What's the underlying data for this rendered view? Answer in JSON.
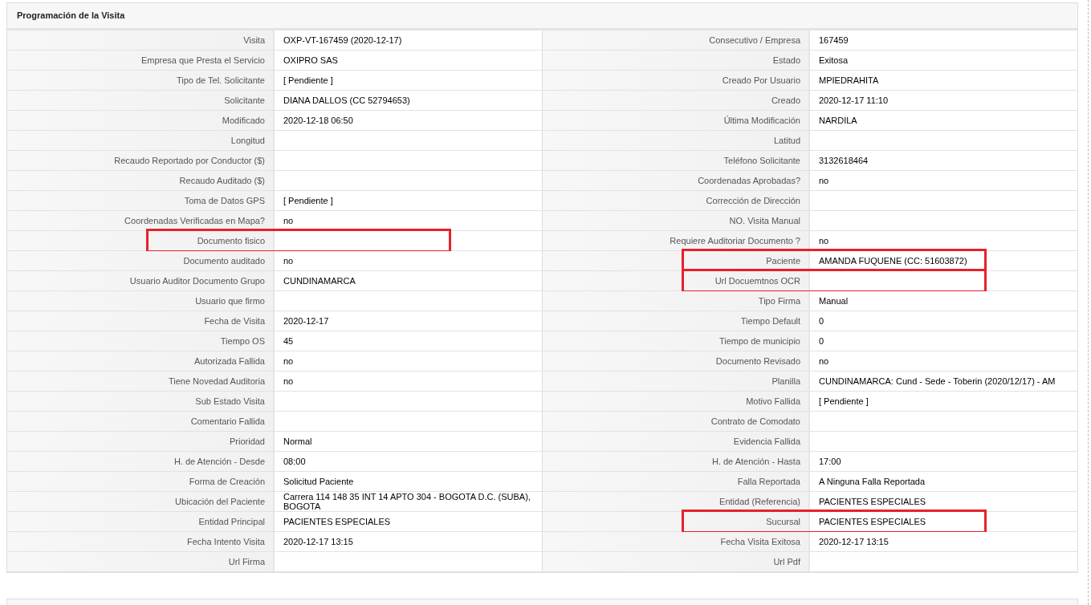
{
  "panel": {
    "title": "Programación de la Visita"
  },
  "rows": [
    {
      "left": {
        "label": "Visita",
        "value": "OXP-VT-167459 (2020-12-17)",
        "highlighted": false
      },
      "right": {
        "label": "Consecutivo / Empresa",
        "value": "167459",
        "highlighted": false
      }
    },
    {
      "left": {
        "label": "Empresa que Presta el Servicio",
        "value": "OXIPRO SAS",
        "highlighted": false
      },
      "right": {
        "label": "Estado",
        "value": "Exitosa",
        "highlighted": false
      }
    },
    {
      "left": {
        "label": "Tipo de Tel. Solicitante",
        "value": "[ Pendiente ]",
        "highlighted": false
      },
      "right": {
        "label": "Creado Por Usuario",
        "value": "MPIEDRAHITA",
        "highlighted": false
      }
    },
    {
      "left": {
        "label": "Solicitante",
        "value": "DIANA DALLOS (CC 52794653)",
        "highlighted": false
      },
      "right": {
        "label": "Creado",
        "value": "2020-12-17 11:10",
        "highlighted": false
      }
    },
    {
      "left": {
        "label": "Modificado",
        "value": "2020-12-18 06:50",
        "highlighted": false
      },
      "right": {
        "label": "Última Modificación",
        "value": "NARDILA",
        "highlighted": false
      }
    },
    {
      "left": {
        "label": "Longitud",
        "highlighted": false
      },
      "right": {
        "label": "Latitud",
        "highlighted": false
      }
    },
    {
      "left": {
        "label": "Recaudo Reportado por Conductor ($)",
        "highlighted": false
      },
      "right": {
        "label": "Teléfono Solicitante",
        "value": "3132618464",
        "highlighted": false
      }
    },
    {
      "left": {
        "label": "Recaudo Auditado ($)",
        "highlighted": false
      },
      "right": {
        "label": "Coordenadas Aprobadas?",
        "value": "no",
        "highlighted": false
      }
    },
    {
      "left": {
        "label": "Toma de Datos GPS",
        "value": "[ Pendiente ]",
        "highlighted": false
      },
      "right": {
        "label": "Corrección de Dirección",
        "highlighted": false
      }
    },
    {
      "left": {
        "label": "Coordenadas Verificadas en Mapa?",
        "value": "no",
        "highlighted": false
      },
      "right": {
        "label": "NO. Visita Manual",
        "highlighted": false
      }
    },
    {
      "left": {
        "label": "Documento fisico",
        "highlighted": true
      },
      "right": {
        "label": "Requiere Auditoriar Documento ?",
        "value": "no",
        "highlighted": false
      }
    },
    {
      "left": {
        "label": "Documento auditado",
        "value": "no",
        "highlighted": false
      },
      "right": {
        "label": "Paciente",
        "value": "AMANDA FUQUENE (CC: 51603872)",
        "highlighted": true
      }
    },
    {
      "left": {
        "label": "Usuario Auditor Documento Grupo",
        "value": "CUNDINAMARCA",
        "highlighted": false
      },
      "right": {
        "label": "Url Docuemtnos OCR",
        "highlighted": true
      }
    },
    {
      "left": {
        "label": "Usuario que firmo",
        "highlighted": false
      },
      "right": {
        "label": "Tipo Firma",
        "value": "Manual",
        "highlighted": false
      }
    },
    {
      "left": {
        "label": "Fecha de Visita",
        "value": "2020-12-17",
        "highlighted": false
      },
      "right": {
        "label": "Tiempo Default",
        "value": "0",
        "highlighted": false
      }
    },
    {
      "left": {
        "label": "Tiempo OS",
        "value": "45",
        "highlighted": false
      },
      "right": {
        "label": "Tiempo de municipio",
        "value": "0",
        "highlighted": false
      }
    },
    {
      "left": {
        "label": "Autorizada Fallida",
        "value": "no",
        "highlighted": false
      },
      "right": {
        "label": "Documento Revisado",
        "value": "no",
        "highlighted": false
      }
    },
    {
      "left": {
        "label": "Tiene Novedad Auditoria",
        "value": "no",
        "highlighted": false
      },
      "right": {
        "label": "Planilla",
        "value": "CUNDINAMARCA: Cund - Sede - Toberin (2020/12/17) - AM",
        "highlighted": false
      }
    },
    {
      "left": {
        "label": "Sub Estado Visita",
        "highlighted": false
      },
      "right": {
        "label": "Motivo Fallida",
        "value": "[ Pendiente ]",
        "highlighted": false
      }
    },
    {
      "left": {
        "label": "Comentario Fallida",
        "highlighted": false
      },
      "right": {
        "label": "Contrato de Comodato",
        "highlighted": false
      }
    },
    {
      "left": {
        "label": "Prioridad",
        "value": "Normal",
        "highlighted": false
      },
      "right": {
        "label": "Evidencia Fallida",
        "highlighted": false
      }
    },
    {
      "left": {
        "label": "H. de Atención - Desde",
        "value": "08:00",
        "highlighted": false
      },
      "right": {
        "label": "H. de Atención - Hasta",
        "value": "17:00",
        "highlighted": false
      }
    },
    {
      "left": {
        "label": "Forma de Creación",
        "value": "Solicitud Paciente",
        "highlighted": false
      },
      "right": {
        "label": "Falla Reportada",
        "value": "A Ninguna Falla Reportada",
        "highlighted": false
      }
    },
    {
      "left": {
        "label": "Ubicación del Paciente",
        "value": "Carrera 114 148 35 INT 14 APTO 304 - BOGOTA D.C. (SUBA), BOGOTA",
        "highlighted": false
      },
      "right": {
        "label": "Entidad (Referencia)",
        "value": "PACIENTES ESPECIALES",
        "highlighted": false
      }
    },
    {
      "left": {
        "label": "Entidad Principal",
        "value": "PACIENTES ESPECIALES",
        "highlighted": false
      },
      "right": {
        "label": "Sucursal",
        "value": "PACIENTES ESPECIALES",
        "highlighted": true
      }
    },
    {
      "left": {
        "label": "Fecha Intento Visita",
        "value": "2020-12-17 13:15",
        "highlighted": false
      },
      "right": {
        "label": "Fecha Visita Exitosa",
        "value": "2020-12-17 13:15",
        "highlighted": false
      }
    },
    {
      "left": {
        "label": "Url Firma",
        "highlighted": false
      },
      "right": {
        "label": "Url Pdf",
        "highlighted": false
      }
    }
  ]
}
